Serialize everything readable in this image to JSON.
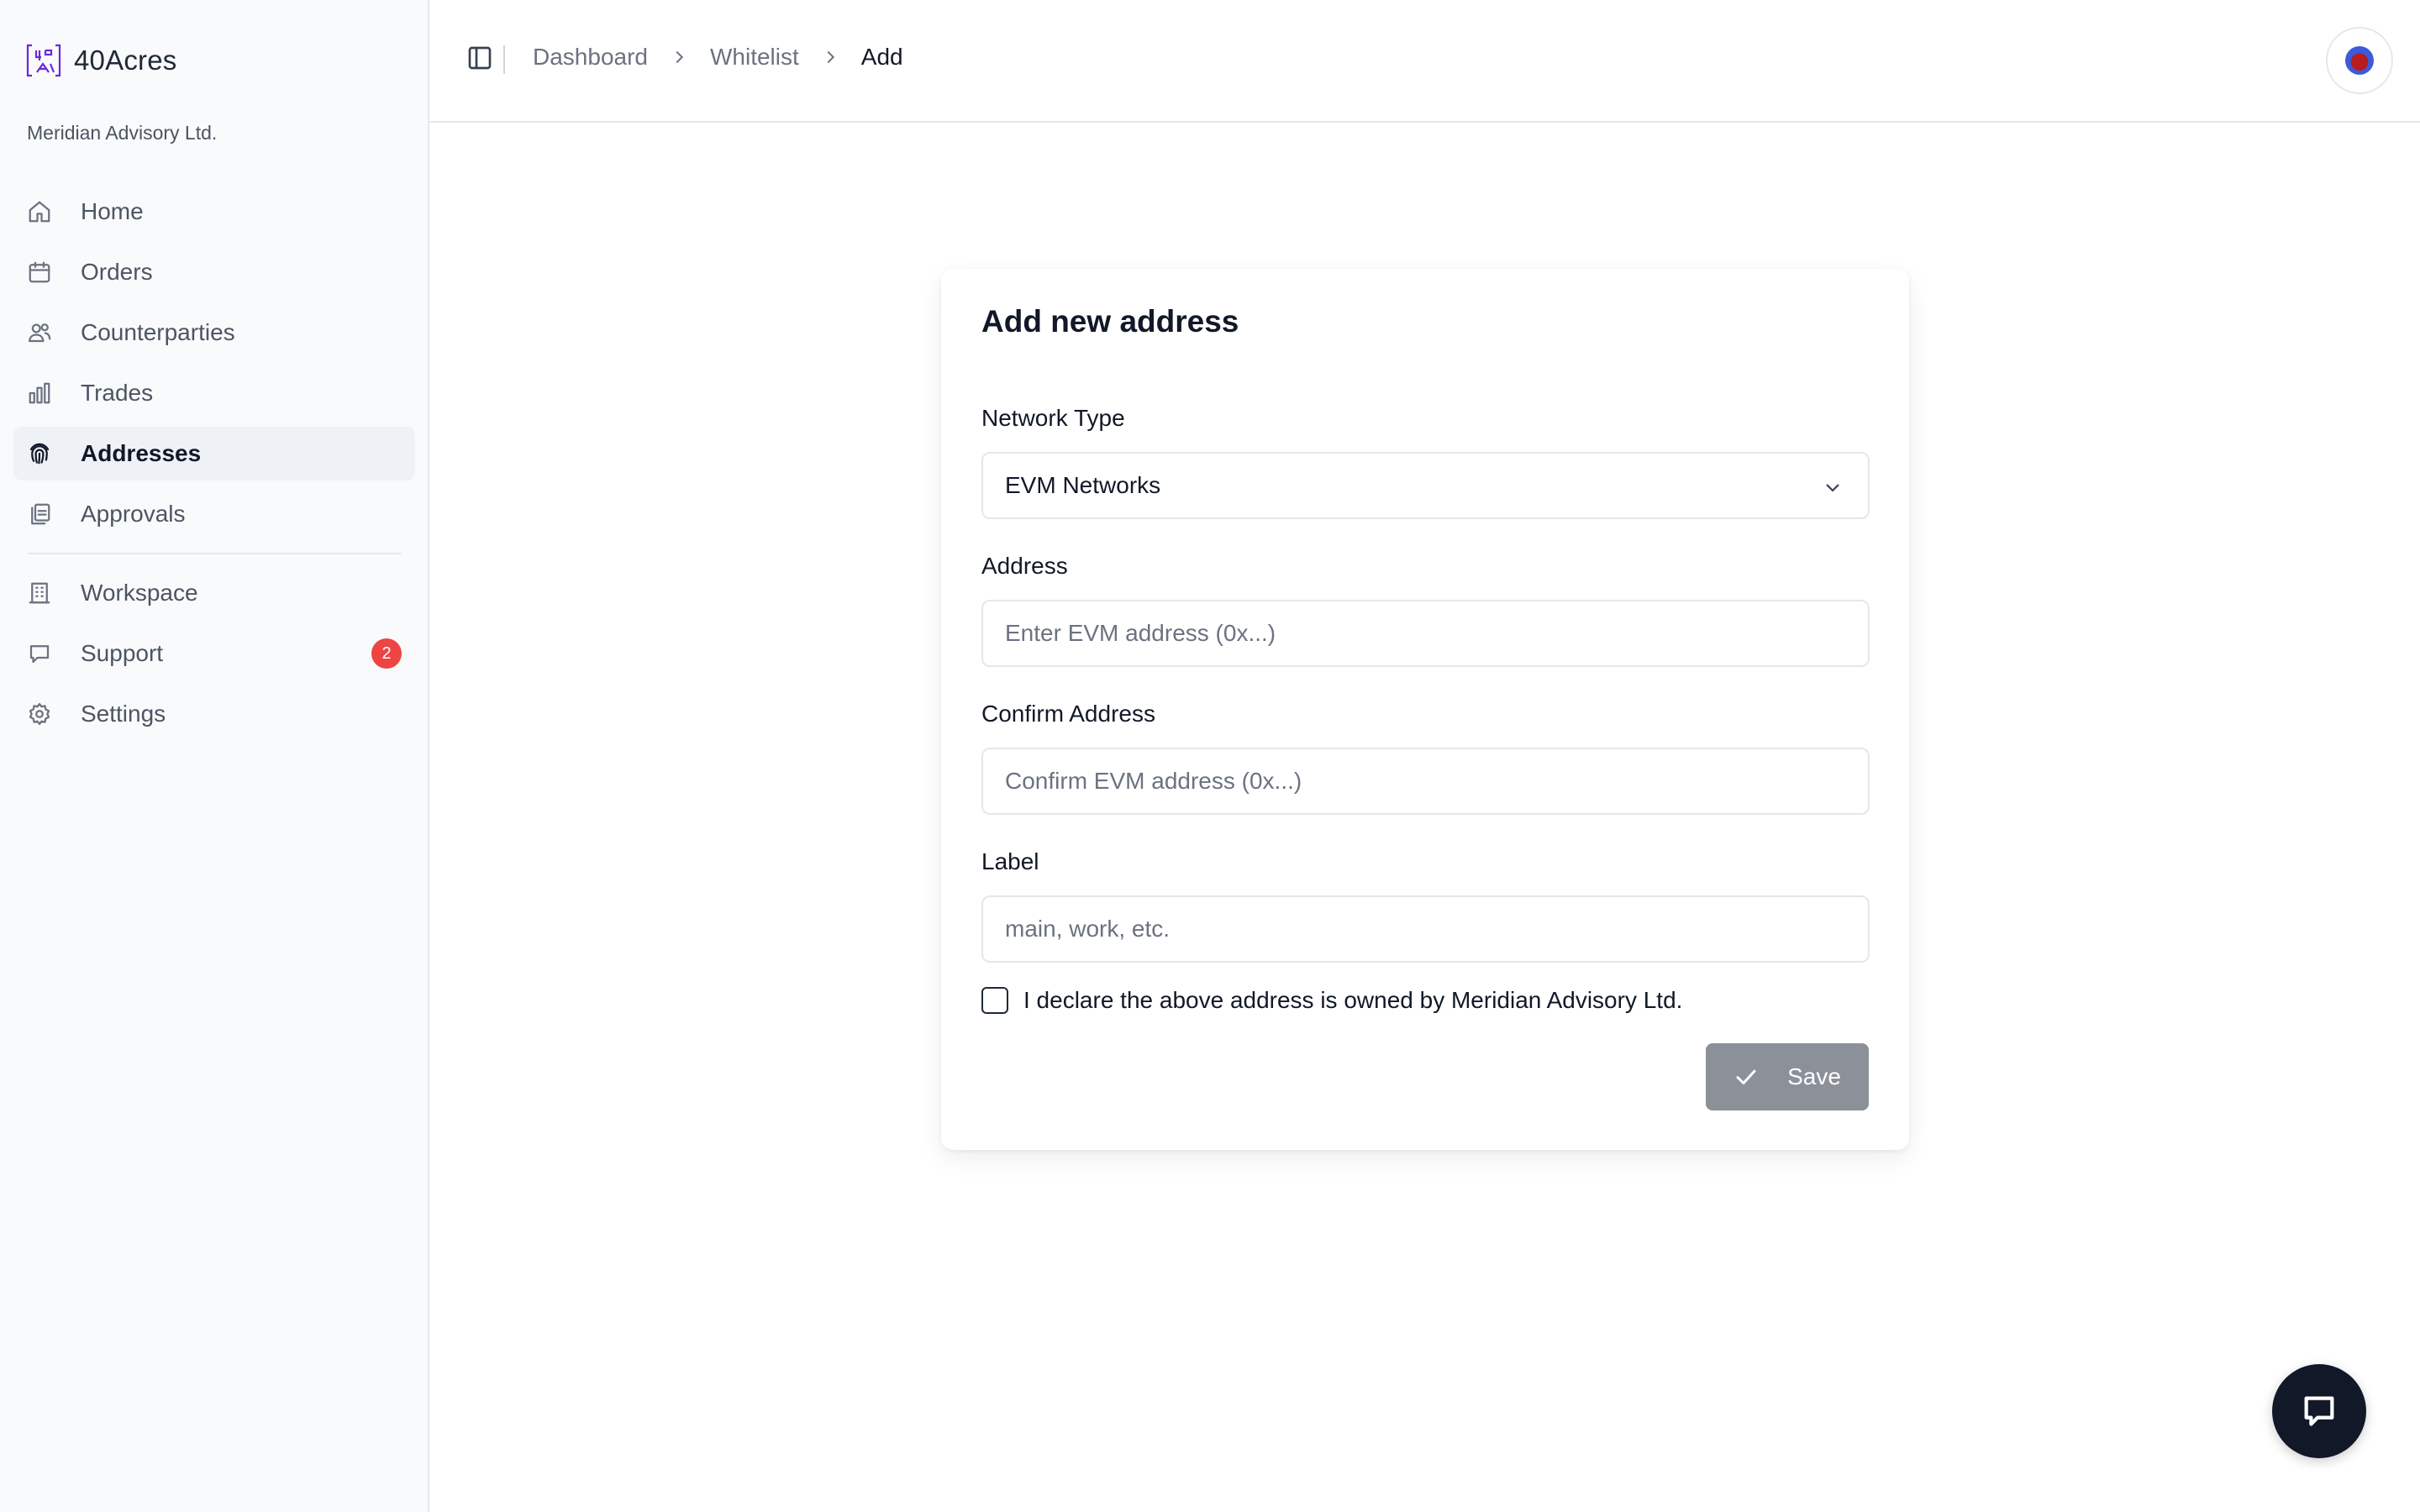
{
  "app": {
    "name": "40Acres",
    "organization": "Meridian Advisory Ltd."
  },
  "sidebar": {
    "items": [
      {
        "label": "Home",
        "icon": "home-icon",
        "active": false
      },
      {
        "label": "Orders",
        "icon": "calendar-icon",
        "active": false
      },
      {
        "label": "Counterparties",
        "icon": "users-icon",
        "active": false
      },
      {
        "label": "Trades",
        "icon": "bar-chart-icon",
        "active": false
      },
      {
        "label": "Addresses",
        "icon": "fingerprint-icon",
        "active": true
      },
      {
        "label": "Approvals",
        "icon": "clipboard-icon",
        "active": false
      }
    ],
    "secondary_items": [
      {
        "label": "Workspace",
        "icon": "building-icon"
      },
      {
        "label": "Support",
        "icon": "message-icon",
        "badge": "2"
      },
      {
        "label": "Settings",
        "icon": "gear-icon"
      }
    ]
  },
  "header": {
    "breadcrumb": [
      "Dashboard",
      "Whitelist",
      "Add"
    ]
  },
  "form": {
    "title": "Add new address",
    "network_type": {
      "label": "Network Type",
      "value": "EVM Networks"
    },
    "address": {
      "label": "Address",
      "placeholder": "Enter EVM address (0x...)",
      "value": ""
    },
    "confirm_address": {
      "label": "Confirm Address",
      "placeholder": "Confirm EVM address (0x...)",
      "value": ""
    },
    "label_field": {
      "label": "Label",
      "placeholder": "main, work, etc.",
      "value": ""
    },
    "declaration": {
      "text": "I declare the above address is owned by Meridian Advisory Ltd.",
      "checked": false
    },
    "save_label": "Save"
  },
  "colors": {
    "brand": "#6d28d9",
    "badge": "#ef4444",
    "save_button": "#8b9099",
    "chat_button": "#111827"
  }
}
